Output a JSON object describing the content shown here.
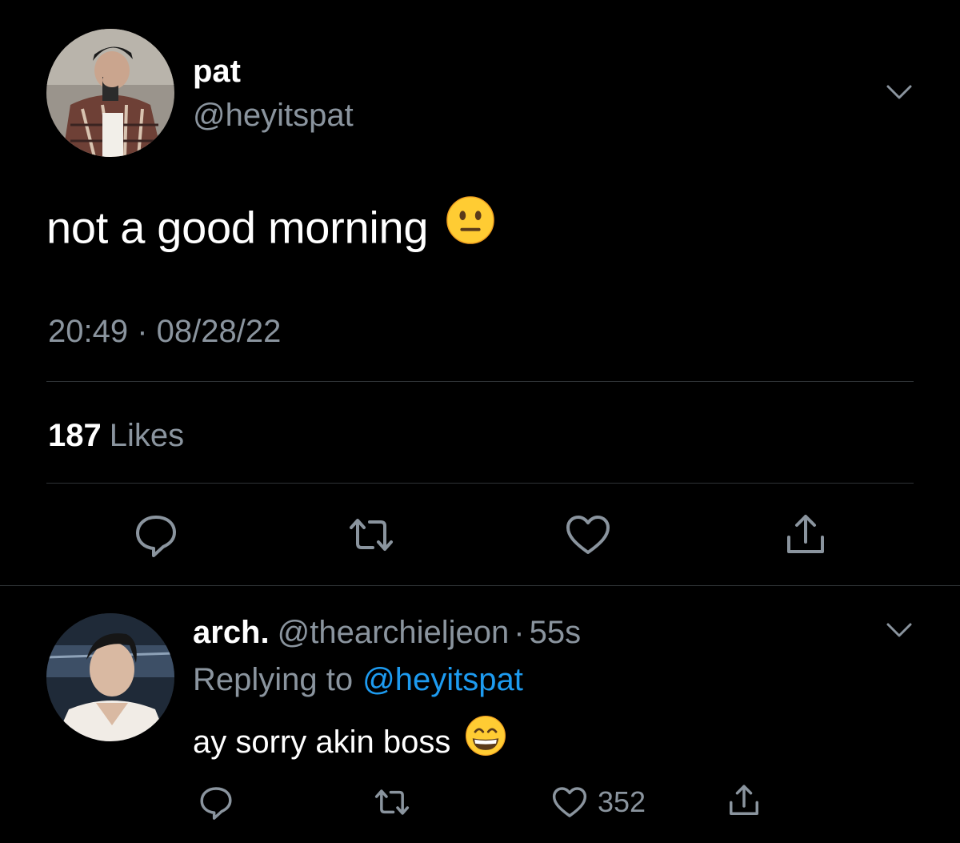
{
  "main_tweet": {
    "display_name": "pat",
    "handle": "@heyitspat",
    "text": "not a good morning",
    "emoji": "neutral-face-emoji",
    "timestamp": "20:49 · 08/28/22",
    "likes_count": "187",
    "likes_label": "Likes",
    "actions": [
      "reply-icon",
      "retweet-icon",
      "like-icon",
      "share-icon"
    ]
  },
  "reply": {
    "display_name": "arch.",
    "handle": "@thearchieljeon",
    "separator": "·",
    "time": "55s",
    "replying_label": "Replying to",
    "replying_to": "@heyitspat",
    "text": "ay sorry akin boss",
    "emoji": "grinning-face-emoji",
    "like_count": "352",
    "actions": [
      "reply-icon",
      "retweet-icon",
      "like-icon",
      "share-icon"
    ]
  },
  "colors": {
    "background": "#000000",
    "primary_text": "#ffffff",
    "secondary_text": "#8a949e",
    "link": "#1d9bf0",
    "divider": "#2f3336"
  }
}
